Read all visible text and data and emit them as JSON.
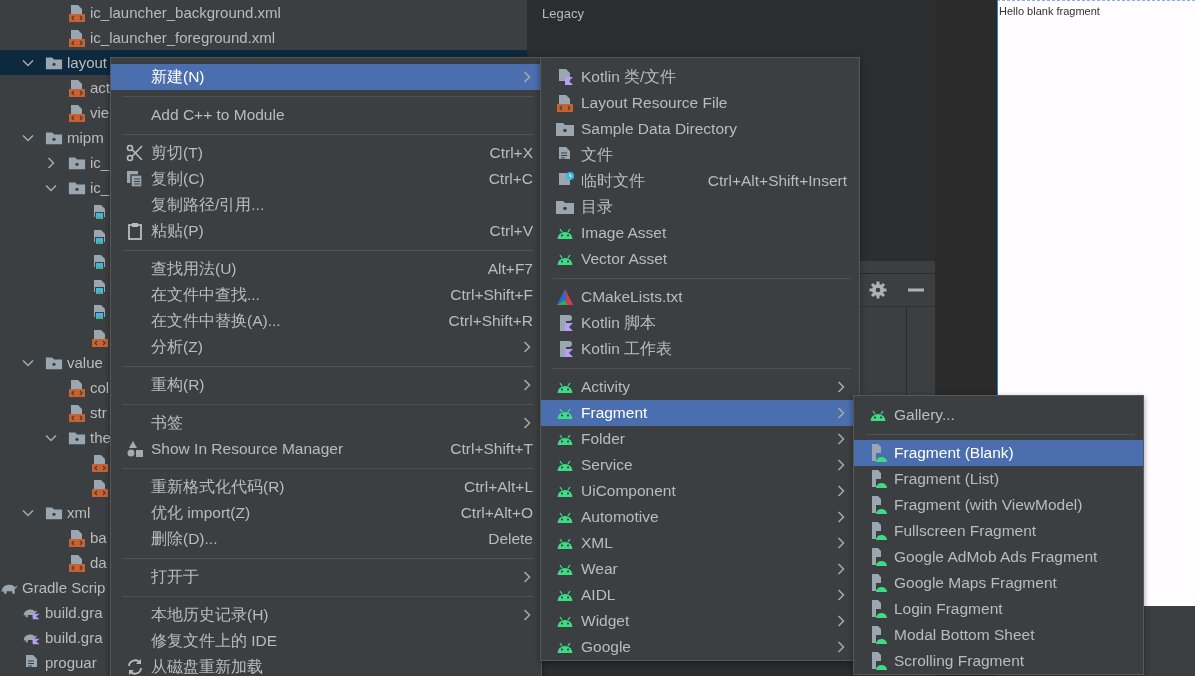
{
  "tree": [
    {
      "children": [
        {
          "children": [
            {
              "children": [
                {
                  "label": "ic_launcher_background.xml",
                  "kind": "xml",
                  "selected": false
                },
                {
                  "label": "ic_launcher_foreground.xml",
                  "kind": "xml",
                  "selected": false
                }
              ]
            },
            {
              "label": "layout",
              "kind": "folder",
              "expanded": true,
              "selected": true,
              "children": [
                {
                  "label": "act",
                  "kind": "xml",
                  "selected": false
                },
                {
                  "label": "vie",
                  "kind": "xml",
                  "selected": false
                }
              ]
            },
            {
              "label": "mipm",
              "kind": "folder",
              "expanded": true,
              "selected": false,
              "children": [
                {
                  "label": "ic_",
                  "kind": "folder",
                  "expanded": false,
                  "selected": false
                },
                {
                  "label": "ic_",
                  "kind": "folder",
                  "expanded": true,
                  "selected": false,
                  "children": [
                    {
                      "kind": "image",
                      "selected": false
                    },
                    {
                      "kind": "image",
                      "selected": false
                    },
                    {
                      "kind": "image",
                      "selected": false
                    },
                    {
                      "kind": "image",
                      "selected": false
                    },
                    {
                      "kind": "image",
                      "selected": false
                    },
                    {
                      "kind": "xml",
                      "selected": false
                    }
                  ]
                }
              ]
            },
            {
              "label": "value",
              "kind": "folder",
              "expanded": true,
              "selected": false,
              "children": [
                {
                  "label": "col",
                  "kind": "xml",
                  "selected": false
                },
                {
                  "label": "str",
                  "kind": "xml",
                  "selected": false
                },
                {
                  "label": "the",
                  "kind": "folder",
                  "expanded": true,
                  "selected": false,
                  "children": [
                    {
                      "kind": "xml",
                      "selected": false
                    },
                    {
                      "kind": "xml",
                      "selected": false
                    }
                  ]
                }
              ]
            },
            {
              "label": "xml",
              "kind": "folder",
              "expanded": true,
              "selected": false,
              "children": [
                {
                  "label": "ba",
                  "kind": "xml",
                  "selected": false
                },
                {
                  "label": "da",
                  "kind": "xml",
                  "selected": false
                }
              ]
            }
          ]
        }
      ]
    },
    {
      "label": "Gradle Scrip",
      "kind": "gradle",
      "selected": false,
      "children": [
        {
          "label": "build.gra",
          "kind": "gradle-kotlin",
          "selected": false
        },
        {
          "label": "build.gra",
          "kind": "gradle-kotlin",
          "selected": false
        },
        {
          "label": "proguar",
          "kind": "text",
          "selected": false
        }
      ]
    }
  ],
  "editor": {
    "label": "Legacy"
  },
  "preview": {
    "text": "Hello blank fragment"
  },
  "context_menu": {
    "items": [
      {
        "kind": "plain",
        "label": "新建(N)",
        "submenu": true,
        "selected": true
      },
      {
        "kind": "separator"
      },
      {
        "kind": "plain",
        "label": "Add C++ to Module",
        "selected": false
      },
      {
        "kind": "separator"
      },
      {
        "kind": "scissors",
        "label": "剪切(T)",
        "shortcut": "Ctrl+X",
        "selected": false
      },
      {
        "kind": "copy",
        "label": "复制(C)",
        "shortcut": "Ctrl+C",
        "selected": false
      },
      {
        "kind": "plain",
        "label": "复制路径/引用...",
        "selected": false
      },
      {
        "kind": "clipboard",
        "label": "粘贴(P)",
        "shortcut": "Ctrl+V",
        "selected": false
      },
      {
        "kind": "separator"
      },
      {
        "kind": "plain",
        "label": "查找用法(U)",
        "shortcut": "Alt+F7",
        "selected": false
      },
      {
        "kind": "plain",
        "label": "在文件中查找...",
        "shortcut": "Ctrl+Shift+F",
        "selected": false
      },
      {
        "kind": "plain",
        "label": "在文件中替换(A)...",
        "shortcut": "Ctrl+Shift+R",
        "selected": false
      },
      {
        "kind": "plain",
        "label": "分析(Z)",
        "submenu": true,
        "selected": false
      },
      {
        "kind": "separator"
      },
      {
        "kind": "plain",
        "label": "重构(R)",
        "submenu": true,
        "selected": false
      },
      {
        "kind": "separator"
      },
      {
        "kind": "plain",
        "label": "书签",
        "submenu": true,
        "selected": false
      },
      {
        "kind": "shapes",
        "label": "Show In Resource Manager",
        "shortcut": "Ctrl+Shift+T",
        "selected": false
      },
      {
        "kind": "separator"
      },
      {
        "kind": "plain",
        "label": "重新格式化代码(R)",
        "shortcut": "Ctrl+Alt+L",
        "selected": false
      },
      {
        "kind": "plain",
        "label": "优化 import(Z)",
        "shortcut": "Ctrl+Alt+O",
        "selected": false
      },
      {
        "kind": "plain",
        "label": "删除(D)...",
        "shortcut": "Delete",
        "selected": false
      },
      {
        "kind": "separator"
      },
      {
        "kind": "plain",
        "label": "打开于",
        "submenu": true,
        "selected": false
      },
      {
        "kind": "separator"
      },
      {
        "kind": "plain",
        "label": "本地历史记录(H)",
        "submenu": true,
        "selected": false
      },
      {
        "kind": "plain",
        "label": "修复文件上的 IDE",
        "selected": false
      },
      {
        "kind": "refresh",
        "label": "从磁盘重新加载",
        "selected": false
      }
    ]
  },
  "new_submenu": {
    "items": [
      {
        "kind": "kotlin-file",
        "label": "Kotlin 类/文件",
        "selected": false
      },
      {
        "kind": "xml",
        "label": "Layout Resource File",
        "selected": false
      },
      {
        "kind": "folder",
        "label": "Sample Data Directory",
        "selected": false
      },
      {
        "kind": "text",
        "label": "文件",
        "selected": false
      },
      {
        "kind": "scratch",
        "label": "临时文件",
        "shortcut": "Ctrl+Alt+Shift+Insert",
        "selected": false
      },
      {
        "kind": "folder",
        "label": "目录",
        "selected": false
      },
      {
        "kind": "android",
        "label": "Image Asset",
        "selected": false
      },
      {
        "kind": "android",
        "label": "Vector Asset",
        "selected": false
      },
      {
        "kind": "separator"
      },
      {
        "kind": "cmake",
        "label": "CMakeLists.txt",
        "selected": false
      },
      {
        "kind": "kotlin-script",
        "label": "Kotlin 脚本",
        "selected": false
      },
      {
        "kind": "kotlin-script",
        "label": "Kotlin 工作表",
        "selected": false
      },
      {
        "kind": "separator"
      },
      {
        "kind": "android",
        "label": "Activity",
        "submenu": true,
        "selected": false
      },
      {
        "kind": "android",
        "label": "Fragment",
        "submenu": true,
        "selected": true
      },
      {
        "kind": "android",
        "label": "Folder",
        "submenu": true,
        "selected": false
      },
      {
        "kind": "android",
        "label": "Service",
        "submenu": true,
        "selected": false
      },
      {
        "kind": "android",
        "label": "UiComponent",
        "submenu": true,
        "selected": false
      },
      {
        "kind": "android",
        "label": "Automotive",
        "submenu": true,
        "selected": false
      },
      {
        "kind": "android",
        "label": "XML",
        "submenu": true,
        "selected": false
      },
      {
        "kind": "android",
        "label": "Wear",
        "submenu": true,
        "selected": false
      },
      {
        "kind": "android",
        "label": "AIDL",
        "submenu": true,
        "selected": false
      },
      {
        "kind": "android",
        "label": "Widget",
        "submenu": true,
        "selected": false
      },
      {
        "kind": "android",
        "label": "Google",
        "submenu": true,
        "selected": false
      }
    ]
  },
  "fragment_submenu": {
    "items": [
      {
        "kind": "android",
        "label": "Gallery...",
        "selected": false
      },
      {
        "kind": "separator"
      },
      {
        "kind": "template",
        "label": "Fragment (Blank)",
        "selected": true
      },
      {
        "kind": "template",
        "label": "Fragment (List)",
        "selected": false
      },
      {
        "kind": "template",
        "label": "Fragment (with ViewModel)",
        "selected": false
      },
      {
        "kind": "template",
        "label": "Fullscreen Fragment",
        "selected": false
      },
      {
        "kind": "template",
        "label": "Google AdMob Ads Fragment",
        "selected": false
      },
      {
        "kind": "template",
        "label": "Google Maps Fragment",
        "selected": false
      },
      {
        "kind": "template",
        "label": "Login Fragment",
        "selected": false
      },
      {
        "kind": "template",
        "label": "Modal Bottom Sheet",
        "selected": false
      },
      {
        "kind": "template",
        "label": "Scrolling Fragment",
        "selected": false
      }
    ]
  }
}
